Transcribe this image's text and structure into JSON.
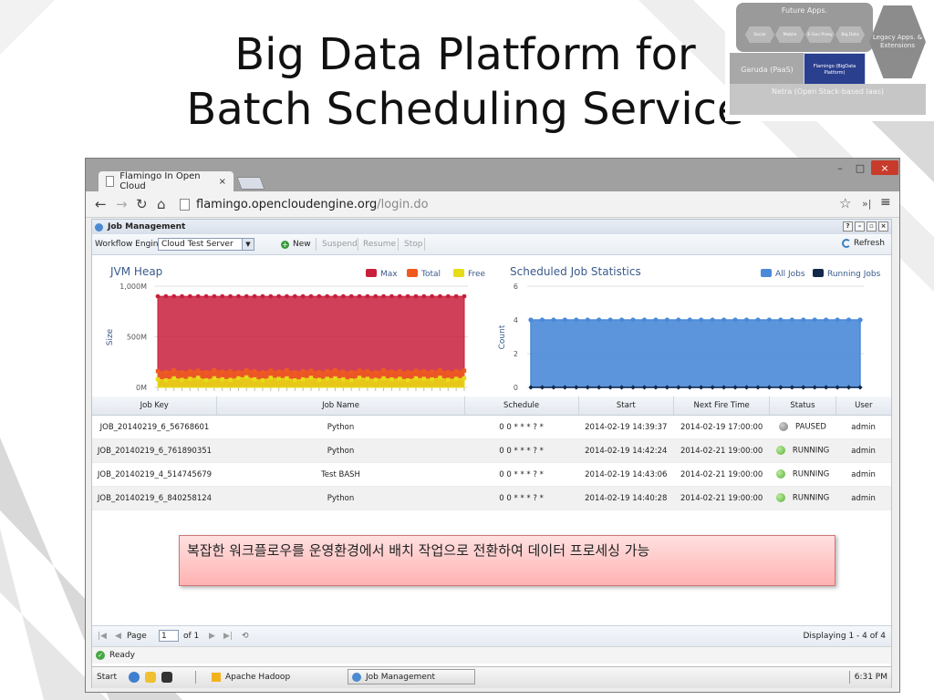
{
  "slide": {
    "title_line1": "Big Data Platform for",
    "title_line2": "Batch Scheduling Service"
  },
  "architecture": {
    "future_apps": "Future Apps.",
    "hex_items": [
      "Social",
      "Mobile",
      "E-Gov Proxy",
      "Big Data"
    ],
    "legacy": "Legacy Apps. & Extensions",
    "garuda": "Garuda (PaaS)",
    "flamingo": "Flamingo (BigData Platform)",
    "netra": "Netra (Open Stack-based Iaas)"
  },
  "browser": {
    "tab_title": "Flamingo In Open Cloud",
    "tab_close": "×",
    "url_host": "flamingo.opencloudengine.org",
    "url_path": "/login.do",
    "window_min": "–",
    "window_max": "□",
    "window_close": "×"
  },
  "app": {
    "panel_title": "Job Management",
    "panel_tools": [
      "?",
      "–",
      "▫",
      "×"
    ],
    "toolbar": {
      "engine_label": "Workflow Engine",
      "engine_value": "Cloud Test Server",
      "new_label": "New",
      "suspend_label": "Suspend",
      "resume_label": "Resume",
      "stop_label": "Stop",
      "refresh_label": "Refresh"
    },
    "grid": {
      "headers": [
        "Job Key",
        "Job Name",
        "Schedule",
        "Start",
        "Next Fire Time",
        "Status",
        "User"
      ],
      "rows": [
        {
          "key": "JOB_20140219_6_56768601",
          "name": "Python",
          "schedule": "0 0 * * * ? *",
          "start": "2014-02-19 14:39:37",
          "next": "2014-02-19 17:00:00",
          "status": "PAUSED",
          "status_color": "#8a8a8a",
          "user": "admin"
        },
        {
          "key": "JOB_20140219_6_761890351",
          "name": "Python",
          "schedule": "0 0 * * * ? *",
          "start": "2014-02-19 14:42:24",
          "next": "2014-02-21 19:00:00",
          "status": "RUNNING",
          "status_color": "#6abf45",
          "user": "admin"
        },
        {
          "key": "JOB_20140219_4_514745679",
          "name": "Test BASH",
          "schedule": "0 0 * * * ? *",
          "start": "2014-02-19 14:43:06",
          "next": "2014-02-21 19:00:00",
          "status": "RUNNING",
          "status_color": "#6abf45",
          "user": "admin"
        },
        {
          "key": "JOB_20140219_6_840258124",
          "name": "Python",
          "schedule": "0 0 * * * ? *",
          "start": "2014-02-19 14:40:28",
          "next": "2014-02-21 19:00:00",
          "status": "RUNNING",
          "status_color": "#6abf45",
          "user": "admin"
        }
      ]
    },
    "note": "복잡한 워크플로우를 운영환경에서 배치 작업으로 전환하여 데이터 프로세싱 가능",
    "pager": {
      "page_label": "Page",
      "page_value": "1",
      "of_label": "of 1",
      "displaying": "Displaying 1 - 4 of 4"
    },
    "status_text": "Ready",
    "taskbar": {
      "start": "Start",
      "hadoop": "Apache Hadoop",
      "job_mgmt": "Job Management",
      "clock": "6:31 PM"
    }
  },
  "chart_data": [
    {
      "type": "area",
      "title": "JVM Heap",
      "ylabel": "Size",
      "ylim": [
        0,
        1000
      ],
      "yticks": [
        "0M",
        "500M",
        "1,000M"
      ],
      "legend_position": "top-right",
      "point_count": 39,
      "series": [
        {
          "name": "Max",
          "color": "#c8203c",
          "values": [
            900,
            900,
            900,
            900,
            900,
            900,
            900,
            900,
            900,
            900,
            900,
            900,
            900,
            900,
            900,
            900,
            900,
            900,
            900,
            900,
            900,
            900,
            900,
            900,
            900,
            900,
            900,
            900,
            900,
            900,
            900,
            900,
            900,
            900,
            900,
            900,
            900,
            900,
            900
          ]
        },
        {
          "name": "Total",
          "color": "#f05a1e",
          "values": [
            160,
            150,
            170,
            150,
            160,
            165,
            150,
            170,
            155,
            160,
            150,
            170,
            160,
            150,
            165,
            155,
            170,
            150,
            160,
            165,
            150,
            160,
            170,
            155,
            150,
            165,
            160,
            150,
            170,
            155,
            160,
            150,
            165,
            160,
            155,
            170,
            150,
            160,
            165
          ]
        },
        {
          "name": "Free",
          "color": "#e6dc18",
          "values": [
            80,
            70,
            90,
            75,
            85,
            95,
            70,
            90,
            80,
            75,
            90,
            100,
            80,
            70,
            95,
            85,
            90,
            70,
            80,
            95,
            75,
            85,
            90,
            80,
            70,
            95,
            85,
            75,
            90,
            80,
            85,
            70,
            90,
            85,
            80,
            95,
            75,
            85,
            90
          ]
        }
      ]
    },
    {
      "type": "area",
      "title": "Scheduled Job Statistics",
      "ylabel": "Count",
      "ylim": [
        0,
        6
      ],
      "yticks": [
        "0",
        "2",
        "4",
        "6"
      ],
      "legend_position": "top-right",
      "point_count": 30,
      "series": [
        {
          "name": "All Jobs",
          "color": "#4a8ad8",
          "values": [
            4,
            4,
            4,
            4,
            4,
            4,
            4,
            4,
            4,
            4,
            4,
            4,
            4,
            4,
            4,
            4,
            4,
            4,
            4,
            4,
            4,
            4,
            4,
            4,
            4,
            4,
            4,
            4,
            4,
            4
          ]
        },
        {
          "name": "Running Jobs",
          "color": "#13294b",
          "values": [
            0,
            0,
            0,
            0,
            0,
            0,
            0,
            0,
            0,
            0,
            0,
            0,
            0,
            0,
            0,
            0,
            0,
            0,
            0,
            0,
            0,
            0,
            0,
            0,
            0,
            0,
            0,
            0,
            0,
            0
          ]
        }
      ]
    }
  ]
}
